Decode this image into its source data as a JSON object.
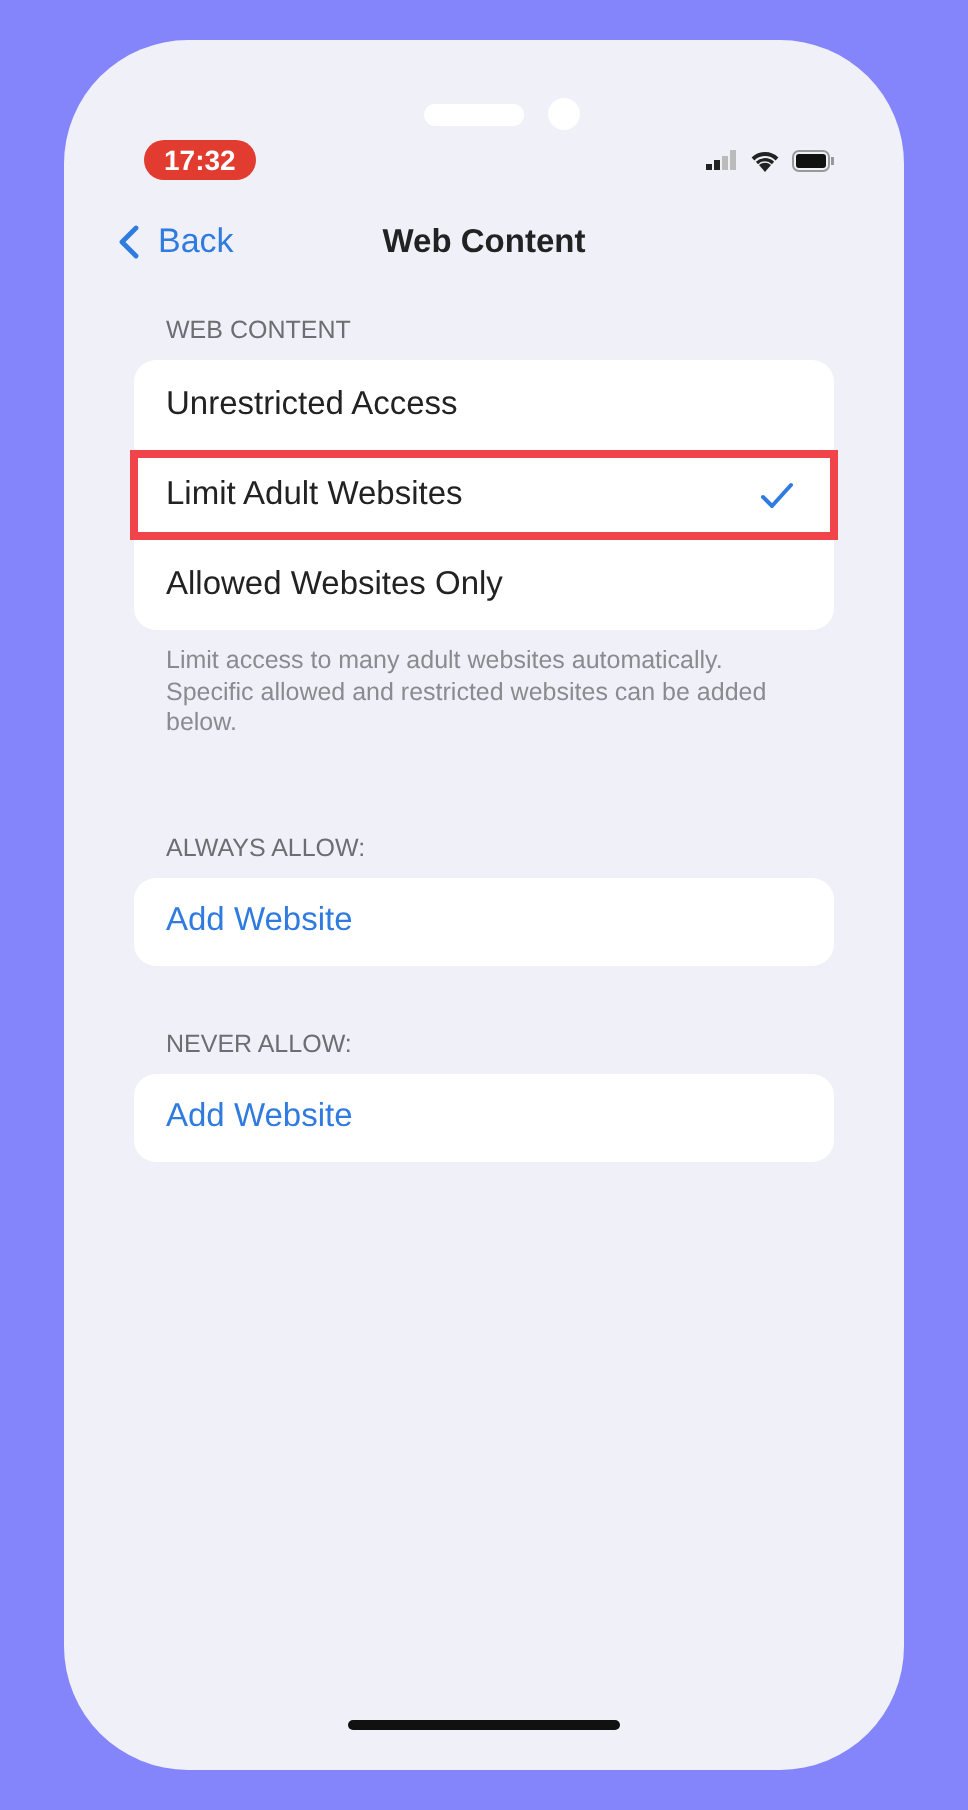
{
  "status_bar": {
    "time": "17:32",
    "time_recording": true
  },
  "nav": {
    "back_label": "Back",
    "title": "Web Content"
  },
  "web_content": {
    "header": "WEB CONTENT",
    "options": [
      {
        "label": "Unrestricted Access",
        "selected": false,
        "highlighted": false
      },
      {
        "label": "Limit Adult Websites",
        "selected": true,
        "highlighted": true
      },
      {
        "label": "Allowed Websites Only",
        "selected": false,
        "highlighted": false
      }
    ],
    "footer": "Limit access to many adult websites automatically. Specific allowed and restricted websites can be added below."
  },
  "always_allow": {
    "header": "ALWAYS ALLOW:",
    "action": "Add Website"
  },
  "never_allow": {
    "header": "NEVER ALLOW:",
    "action": "Add Website"
  }
}
